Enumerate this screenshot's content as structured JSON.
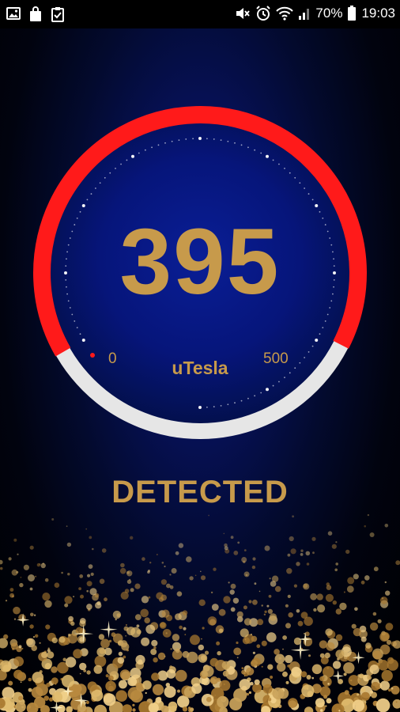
{
  "status_bar": {
    "battery_percent": "70%",
    "time": "19:03",
    "left_icons": [
      "image-icon",
      "bag-icon",
      "clipboard-check-icon"
    ],
    "right_icons": [
      "mute-icon",
      "alarm-icon",
      "wifi-icon",
      "signal-icon",
      "battery-icon"
    ]
  },
  "gauge": {
    "value": "395",
    "unit": "uTesla",
    "min_label": "0",
    "max_label": "500",
    "level_fraction": 0.79,
    "arc_color": "#ff1a1a",
    "track_color": "#e6e6e6",
    "face_color": "#06157a"
  },
  "detection_status": "DETECTED",
  "colors": {
    "gold": "#c79a4b",
    "background": "#020620"
  }
}
